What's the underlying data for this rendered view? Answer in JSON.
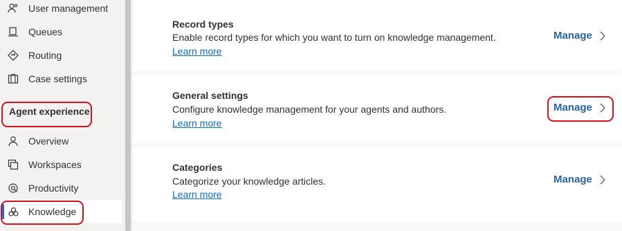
{
  "sidebar": {
    "items_top": [
      {
        "label": "User management",
        "icon": "user-management-icon"
      },
      {
        "label": "Queues",
        "icon": "queues-icon"
      },
      {
        "label": "Routing",
        "icon": "routing-icon"
      },
      {
        "label": "Case settings",
        "icon": "case-settings-icon"
      }
    ],
    "group_header": "Agent experience",
    "items_group": [
      {
        "label": "Overview",
        "icon": "overview-icon"
      },
      {
        "label": "Workspaces",
        "icon": "workspaces-icon"
      },
      {
        "label": "Productivity",
        "icon": "productivity-icon"
      },
      {
        "label": "Knowledge",
        "icon": "knowledge-icon",
        "selected": true
      }
    ]
  },
  "cards": [
    {
      "title": "Record types",
      "description": "Enable record types for which you want to turn on knowledge management.",
      "link": "Learn more",
      "action": "Manage"
    },
    {
      "title": "General settings",
      "description": "Configure knowledge management for your agents and authors.",
      "link": "Learn more",
      "action": "Manage"
    },
    {
      "title": "Categories",
      "description": "Categorize your knowledge articles.",
      "link": "Learn more",
      "action": "Manage"
    }
  ],
  "colors": {
    "accent": "#2266e3",
    "link": "#0f6cbd",
    "manage": "#2b64a3",
    "annotation": "#d4121e"
  }
}
